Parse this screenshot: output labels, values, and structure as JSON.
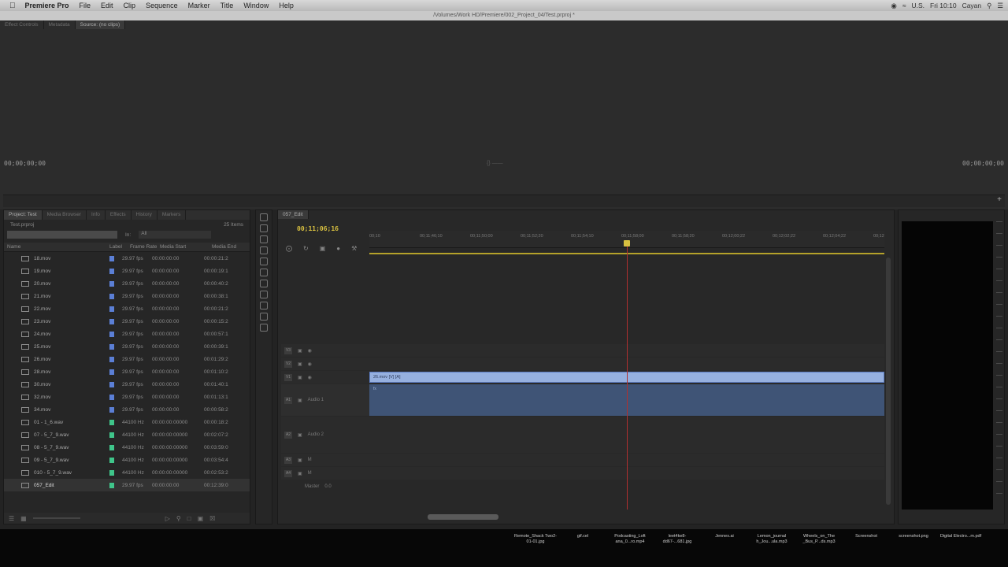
{
  "menubar": {
    "app": "Premiere Pro",
    "items": [
      "File",
      "Edit",
      "Clip",
      "Sequence",
      "Marker",
      "Title",
      "Window",
      "Help"
    ],
    "clock": "Fri 10:10",
    "user": "Cayan",
    "lang": "U.S."
  },
  "window": {
    "title": "/Volumes/Work HD/Premiere/002_Project_04/Test.prproj *"
  },
  "source": {
    "tabs": [
      "Effect Controls",
      "Metadata",
      "Source: (no clips)"
    ],
    "tc_left": "00;00;00;00",
    "tc_right": "00;00;00;00",
    "center_ind": "{}  ——"
  },
  "project": {
    "tabs": [
      "Project: Test",
      "Media Browser",
      "Info",
      "Effects",
      "History",
      "Markers"
    ],
    "file": "Test.prproj",
    "count": "25 Items",
    "search": "",
    "in_label": "In:",
    "in_value": "All",
    "columns": [
      "Name",
      "Label",
      "Frame Rate",
      "Media Start",
      "Media End"
    ],
    "rows": [
      {
        "name": "18.mov",
        "fr": "29.97 fps",
        "ms": "00:00:00:00",
        "me": "00:00:21:2",
        "color": "#5b7fd6"
      },
      {
        "name": "19.mov",
        "fr": "29.97 fps",
        "ms": "00:00:00:00",
        "me": "00:00:19:1",
        "color": "#5b7fd6"
      },
      {
        "name": "20.mov",
        "fr": "29.97 fps",
        "ms": "00:00:00:00",
        "me": "00:00:40:2",
        "color": "#5b7fd6"
      },
      {
        "name": "21.mov",
        "fr": "29.97 fps",
        "ms": "00:00:00:00",
        "me": "00:00:38:1",
        "color": "#5b7fd6"
      },
      {
        "name": "22.mov",
        "fr": "29.97 fps",
        "ms": "00:00:00:00",
        "me": "00:00:21:2",
        "color": "#5b7fd6"
      },
      {
        "name": "23.mov",
        "fr": "29.97 fps",
        "ms": "00:00:00:00",
        "me": "00:00:15:2",
        "color": "#5b7fd6"
      },
      {
        "name": "24.mov",
        "fr": "29.97 fps",
        "ms": "00:00:00:00",
        "me": "00:00:57:1",
        "color": "#5b7fd6"
      },
      {
        "name": "25.mov",
        "fr": "29.97 fps",
        "ms": "00:00:00:00",
        "me": "00:00:39:1",
        "color": "#5b7fd6"
      },
      {
        "name": "26.mov",
        "fr": "29.97 fps",
        "ms": "00:00:00:00",
        "me": "00:01:29:2",
        "color": "#5b7fd6"
      },
      {
        "name": "28.mov",
        "fr": "29.97 fps",
        "ms": "00:00:00:00",
        "me": "00:01:10:2",
        "color": "#5b7fd6"
      },
      {
        "name": "30.mov",
        "fr": "29.97 fps",
        "ms": "00:00:00:00",
        "me": "00:01:40:1",
        "color": "#5b7fd6"
      },
      {
        "name": "32.mov",
        "fr": "29.97 fps",
        "ms": "00:00:00:00",
        "me": "00:01:13:1",
        "color": "#5b7fd6"
      },
      {
        "name": "34.mov",
        "fr": "29.97 fps",
        "ms": "00:00:00:00",
        "me": "00:00:58:2",
        "color": "#5b7fd6"
      },
      {
        "name": "01 - 1_6.wav",
        "fr": "44100 Hz",
        "ms": "00:00:00:00000",
        "me": "00:00:18:2",
        "color": "#3fc58a"
      },
      {
        "name": "07 - 5_7_9.wav",
        "fr": "44100 Hz",
        "ms": "00:00:00:00000",
        "me": "00:02:07:2",
        "color": "#3fc58a"
      },
      {
        "name": "08 - 5_7_9.wav",
        "fr": "44100 Hz",
        "ms": "00:00:00:00000",
        "me": "00:03:59:0",
        "color": "#3fc58a"
      },
      {
        "name": "09 - 5_7_9.wav",
        "fr": "44100 Hz",
        "ms": "00:00:00:00000",
        "me": "00:03:54:4",
        "color": "#3fc58a"
      },
      {
        "name": "010 - 5_7_9.wav",
        "fr": "44100 Hz",
        "ms": "00:00:00:00000",
        "me": "00:02:53:2",
        "color": "#3fc58a"
      },
      {
        "name": "057_Edit",
        "fr": "29.97 fps",
        "ms": "00:00:00:00",
        "me": "00:12:39:0",
        "color": "#3fc58a"
      }
    ]
  },
  "timeline": {
    "tab": "057_Edit",
    "timecode": "00;11;06;16",
    "ticks": [
      "00;10",
      "00;11;46;10",
      "00;11;50;00",
      "00;11;52;20",
      "00;11;54;10",
      "00;11;58;00",
      "00;11;58;20",
      "00;12;00;22",
      "00;12;02;22",
      "00;12;04;22",
      "00;12"
    ],
    "tracks": {
      "v3": "V3",
      "v2": "V2",
      "v1": "V1",
      "a1": "A1",
      "a2": "A2",
      "a3": "A3",
      "a4": "A4",
      "audio1": "Audio 1",
      "audio2": "Audio 2",
      "master": "Master",
      "master_val": "0.0"
    },
    "clip_label": "26.mov [V] [A]",
    "clip_audio_label": "fx"
  },
  "dock": {
    "files": [
      "Remote_Shack Two2-01-01.jpg",
      "gif.cel",
      "Podcasting_Loft ana_0...ro.mp4",
      "leet4ke8-dd67-...681.jpg",
      "Jennex.ai",
      "Lemon_journal h_Jou...ula.mp3",
      "Wheels_on_The _Bus_P...ds.mp3",
      "Screenshot",
      "screenshot.png",
      "Digital Electro...m.pdf"
    ]
  },
  "colors": {
    "accent": "#d8c040",
    "clip_video": "#96b0df",
    "clip_audio": "#3f5476",
    "playhead": "#b03030"
  }
}
